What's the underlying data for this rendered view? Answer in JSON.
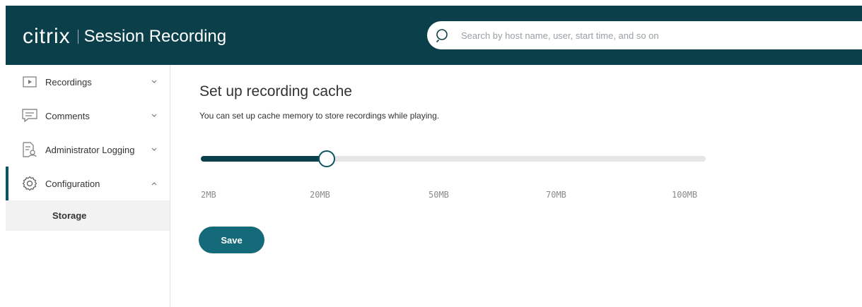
{
  "header": {
    "logo_text": "citrix",
    "product_name": "Session Recording",
    "search": {
      "placeholder": "Search by host name, user, start time, and so on",
      "value": "",
      "icon": "search-icon"
    },
    "background_color": "#0b3f4a"
  },
  "sidebar": {
    "items": [
      {
        "label": "Recordings",
        "icon": "play-icon",
        "expanded": false
      },
      {
        "label": "Comments",
        "icon": "comment-icon",
        "expanded": false
      },
      {
        "label": "Administrator Logging",
        "icon": "log-document-icon",
        "expanded": false
      },
      {
        "label": "Configuration",
        "icon": "gear-icon",
        "expanded": true,
        "active": true
      }
    ],
    "sub_items": [
      {
        "label": "Storage",
        "selected": true
      }
    ]
  },
  "main": {
    "title": "Set up recording cache",
    "description": "You can set up cache memory to store recordings while playing.",
    "slider": {
      "labels": [
        "2MB",
        "20MB",
        "50MB",
        "70MB",
        "100MB"
      ],
      "selected_label": "20MB",
      "selected_index": 1
    },
    "save_label": "Save"
  },
  "colors": {
    "accent": "#0b5563",
    "button": "#156a7a",
    "track": "#e6e6e6",
    "selected_bg": "#f2f2f2"
  }
}
